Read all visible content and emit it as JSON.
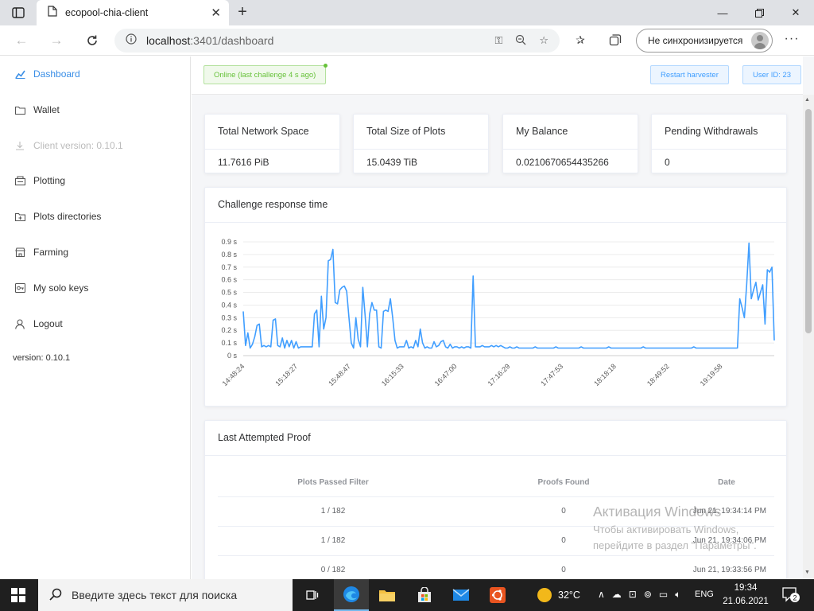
{
  "browser": {
    "tab_title": "ecopool-chia-client",
    "url_host": "localhost",
    "url_rest": ":3401/dashboard",
    "profile_label": "Не синхронизируется"
  },
  "sidebar": {
    "items": [
      {
        "label": "Dashboard",
        "icon": "chart-icon",
        "state": "active"
      },
      {
        "label": "Wallet",
        "icon": "folder-icon",
        "state": "normal"
      },
      {
        "label": "Client version: 0.10.1",
        "icon": "download-icon",
        "state": "disabled"
      },
      {
        "label": "Plotting",
        "icon": "plotting-icon",
        "state": "normal"
      },
      {
        "label": "Plots directories",
        "icon": "folder-plus-icon",
        "state": "normal"
      },
      {
        "label": "Farming",
        "icon": "shop-icon",
        "state": "normal"
      },
      {
        "label": "My solo keys",
        "icon": "key-icon",
        "state": "normal"
      },
      {
        "label": "Logout",
        "icon": "user-icon",
        "state": "normal"
      }
    ],
    "version": "version: 0.10.1"
  },
  "topbar": {
    "status": "Online (last challenge 4 s ago)",
    "restart_label": "Restart harvester",
    "user_id": "User ID: 23"
  },
  "stats": [
    {
      "label": "Total Network Space",
      "value": "11.7616 PiB"
    },
    {
      "label": "Total Size of Plots",
      "value": "15.0439 TiB"
    },
    {
      "label": "My Balance",
      "value": "0.0210670654435266"
    },
    {
      "label": "Pending Withdrawals",
      "value": "0"
    }
  ],
  "chart_card": {
    "title": "Challenge response time"
  },
  "chart_data": {
    "type": "line",
    "title": "Challenge response time",
    "ylim": [
      0,
      0.9
    ],
    "yticks": [
      "0 s",
      "0.1 s",
      "0.2 s",
      "0.3 s",
      "0.4 s",
      "0.5 s",
      "0.6 s",
      "0.7 s",
      "0.8 s",
      "0.9 s"
    ],
    "xticks": [
      "14:48:24",
      "15:18:27",
      "15:48:47",
      "16:15:33",
      "16:47:00",
      "17:16:29",
      "17:47:53",
      "18:18:18",
      "18:49:52",
      "19:19:58"
    ],
    "grid": true,
    "color": "#409eff",
    "values": [
      0.35,
      0.08,
      0.18,
      0.06,
      0.09,
      0.15,
      0.24,
      0.25,
      0.07,
      0.08,
      0.07,
      0.08,
      0.07,
      0.28,
      0.29,
      0.08,
      0.07,
      0.14,
      0.06,
      0.12,
      0.07,
      0.12,
      0.06,
      0.11,
      0.06,
      0.07,
      0.07,
      0.07,
      0.07,
      0.07,
      0.07,
      0.33,
      0.36,
      0.07,
      0.47,
      0.21,
      0.3,
      0.75,
      0.76,
      0.84,
      0.42,
      0.41,
      0.52,
      0.54,
      0.55,
      0.51,
      0.3,
      0.1,
      0.06,
      0.3,
      0.13,
      0.07,
      0.54,
      0.32,
      0.07,
      0.33,
      0.42,
      0.36,
      0.36,
      0.07,
      0.06,
      0.35,
      0.36,
      0.35,
      0.45,
      0.3,
      0.12,
      0.06,
      0.07,
      0.07,
      0.07,
      0.12,
      0.06,
      0.07,
      0.06,
      0.12,
      0.07,
      0.21,
      0.1,
      0.06,
      0.07,
      0.06,
      0.06,
      0.11,
      0.07,
      0.08,
      0.11,
      0.12,
      0.07,
      0.06,
      0.09,
      0.06,
      0.07,
      0.07,
      0.06,
      0.07,
      0.06,
      0.07,
      0.07,
      0.06,
      0.63,
      0.07,
      0.07,
      0.07,
      0.08,
      0.07,
      0.07,
      0.07,
      0.08,
      0.07,
      0.08,
      0.07,
      0.08,
      0.07,
      0.06,
      0.06,
      0.07,
      0.06,
      0.06,
      0.07,
      0.06,
      0.06,
      0.06,
      0.06,
      0.06,
      0.06,
      0.06,
      0.07,
      0.06,
      0.06,
      0.06,
      0.06,
      0.06,
      0.06,
      0.06,
      0.06,
      0.07,
      0.06,
      0.06,
      0.06,
      0.06,
      0.06,
      0.06,
      0.06,
      0.06,
      0.06,
      0.06,
      0.07,
      0.06,
      0.06,
      0.06,
      0.06,
      0.06,
      0.06,
      0.06,
      0.06,
      0.06,
      0.06,
      0.06,
      0.07,
      0.06,
      0.06,
      0.06,
      0.06,
      0.06,
      0.06,
      0.06,
      0.06,
      0.06,
      0.06,
      0.06,
      0.06,
      0.06,
      0.06,
      0.07,
      0.06,
      0.06,
      0.06,
      0.06,
      0.06,
      0.06,
      0.06,
      0.06,
      0.06,
      0.06,
      0.06,
      0.06,
      0.06,
      0.06,
      0.06,
      0.06,
      0.06,
      0.06,
      0.06,
      0.06,
      0.06,
      0.07,
      0.06,
      0.06,
      0.06,
      0.06,
      0.06,
      0.06,
      0.06,
      0.06,
      0.06,
      0.06,
      0.06,
      0.06,
      0.06,
      0.06,
      0.06,
      0.06,
      0.06,
      0.06,
      0.06,
      0.45,
      0.38,
      0.3,
      0.56,
      0.89,
      0.45,
      0.52,
      0.58,
      0.44,
      0.5,
      0.56,
      0.25,
      0.68,
      0.66,
      0.7,
      0.12
    ]
  },
  "proof_card": {
    "title": "Last Attempted Proof"
  },
  "proofs": {
    "columns": [
      "Plots Passed Filter",
      "Proofs Found",
      "Date"
    ],
    "rows": [
      [
        "1 / 182",
        "0",
        "Jun 21, 19:34:14 PM"
      ],
      [
        "1 / 182",
        "0",
        "Jun 21, 19:34:06 PM"
      ],
      [
        "0 / 182",
        "0",
        "Jun 21, 19:33:56 PM"
      ]
    ]
  },
  "watermark": {
    "line1": "Активация Windows",
    "line2": "Чтобы активировать Windows,",
    "line3": "перейдите в раздел \"Параметры\"."
  },
  "taskbar": {
    "search_placeholder": "Введите здесь текст для поиска",
    "temperature": "32°C",
    "lang": "ENG",
    "time": "19:34",
    "date": "21.06.2021",
    "notifications": "2"
  }
}
